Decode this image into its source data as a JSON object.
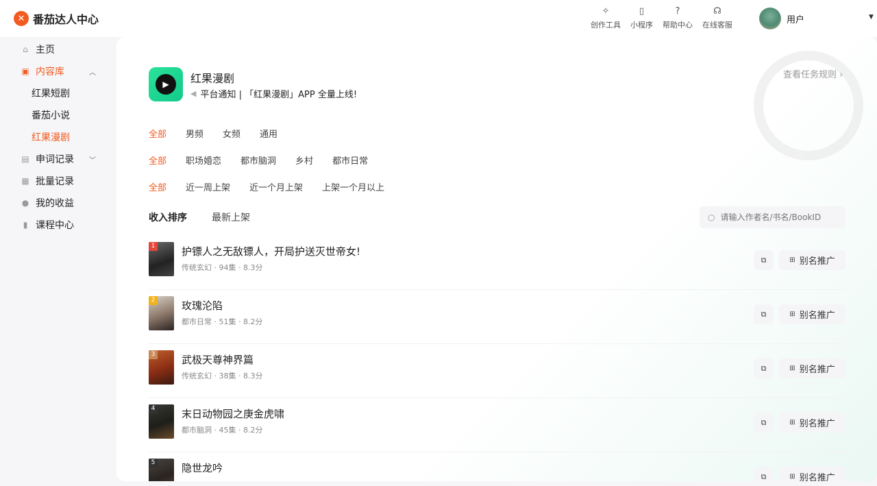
{
  "brand": {
    "name": "番茄达人中心"
  },
  "topnav": [
    {
      "label": "创作工具",
      "icon": "sparkle-icon"
    },
    {
      "label": "小程序",
      "icon": "phone-icon"
    },
    {
      "label": "帮助中心",
      "icon": "help-icon"
    },
    {
      "label": "在线客服",
      "icon": "headset-icon"
    }
  ],
  "user": {
    "name": "用户"
  },
  "sidebar": {
    "items": [
      {
        "label": "主页"
      },
      {
        "label": "内容库"
      },
      {
        "label": "红果短剧"
      },
      {
        "label": "番茄小说"
      },
      {
        "label": "红果漫剧"
      },
      {
        "label": "申词记录"
      },
      {
        "label": "批量记录"
      },
      {
        "label": "我的收益"
      },
      {
        "label": "课程中心"
      }
    ]
  },
  "header": {
    "title": "红果漫剧",
    "notice": "平台通知 | 「红果漫剧」APP 全量上线!",
    "rules_link": "查看任务规则 ›"
  },
  "filters": {
    "row1": [
      "全部",
      "男频",
      "女频",
      "通用"
    ],
    "row2": [
      "全部",
      "职场婚恋",
      "都市脑洞",
      "乡村",
      "都市日常"
    ],
    "row3": [
      "全部",
      "近一周上架",
      "近一个月上架",
      "上架一个月以上"
    ]
  },
  "sort_tabs": [
    "收入排序",
    "最新上架"
  ],
  "search": {
    "placeholder": "请输入作者名/书名/BookID"
  },
  "colors": {
    "accent": "#f25a1f"
  },
  "list": {
    "copy_icon": "copy-icon",
    "alias_label": "别名推广",
    "items": [
      {
        "rank": "1",
        "title": "护镖人之无敌镖人，开局护送灭世帝女!",
        "meta": "传统玄幻 · 94集 · 8.3分"
      },
      {
        "rank": "2",
        "title": "玫瑰沦陷",
        "meta": "都市日常 · 51集 · 8.2分"
      },
      {
        "rank": "3",
        "title": "武极天尊神界篇",
        "meta": "传统玄幻 · 38集 · 8.3分"
      },
      {
        "rank": "4",
        "title": "末日动物园之庚金虎啸",
        "meta": "都市脑洞 · 45集 · 8.2分"
      },
      {
        "rank": "5",
        "title": "隐世龙吟",
        "meta": ""
      }
    ]
  }
}
